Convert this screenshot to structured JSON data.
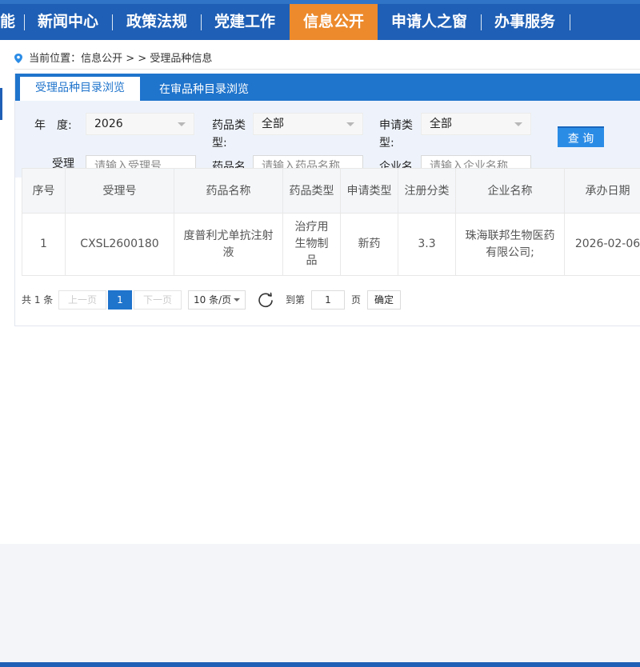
{
  "nav": {
    "items": [
      "能",
      "新闻中心",
      "政策法规",
      "党建工作",
      "信息公开",
      "申请人之窗",
      "办事服务"
    ],
    "active_index": 4
  },
  "breadcrumb": {
    "text": "当前位置：信息公开 > > 受理品种信息"
  },
  "tabs": [
    {
      "label": "受理品种目录浏览",
      "active": true
    },
    {
      "label": "在审品种目录浏览",
      "active": false
    }
  ],
  "filters": {
    "year_label": "年　度:",
    "year_value": "2026",
    "drug_type_label": "药品类型:",
    "drug_type_value": "全部",
    "apply_type_label": "申请类型:",
    "apply_type_value": "全部",
    "accept_no_label": "受理号:",
    "accept_no_placeholder": "请输入受理号",
    "drug_name_label": "药品名称:",
    "drug_name_placeholder": "请输入药品名称",
    "company_label": "企业名称:",
    "company_placeholder": "请输入企业名称",
    "query_button": "查 询"
  },
  "table": {
    "headers": [
      "序号",
      "受理号",
      "药品名称",
      "药品类型",
      "申请类型",
      "注册分类",
      "企业名称",
      "承办日期"
    ],
    "rows": [
      [
        "1",
        "CXSL2600180",
        "度普利尤单抗注射液",
        "治疗用生物制品",
        "新药",
        "3.3",
        "珠海联邦生物医药有限公司;",
        "2026-02-06"
      ]
    ]
  },
  "pagination": {
    "total_text": "共 1 条",
    "prev_label": "上一页",
    "current_page": "1",
    "next_label": "下一页",
    "page_size": "10 条/页",
    "goto_label": "到第",
    "goto_value": "1",
    "page_unit": "页",
    "confirm_label": "确定"
  },
  "colors": {
    "nav_bg": "#1f5fb5",
    "nav_active": "#ec8a2c",
    "tab_bar": "#1f74cc",
    "query_button": "#2b8ce6"
  }
}
